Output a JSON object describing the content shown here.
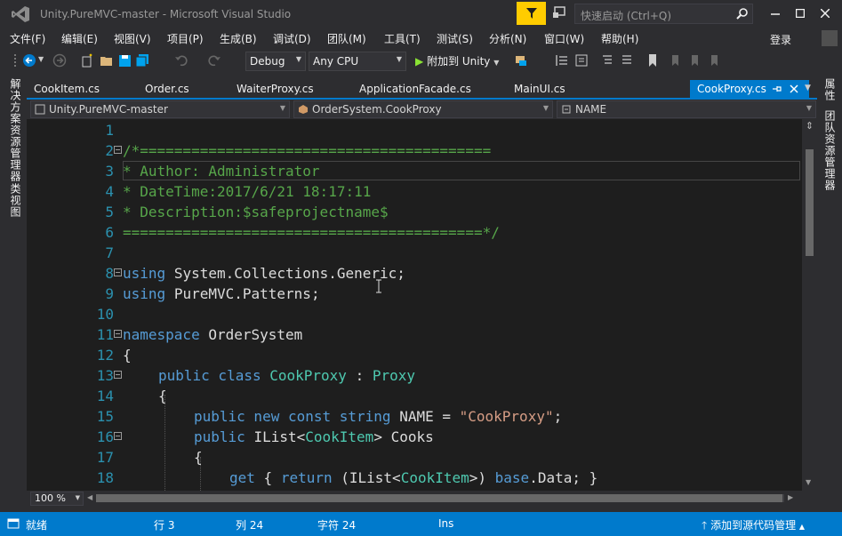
{
  "window": {
    "title": "Unity.PureMVC-master - Microsoft Visual Studio",
    "quick_launch_placeholder": "快速启动 (Ctrl+Q)",
    "login": "登录"
  },
  "menu": [
    "文件(F)",
    "编辑(E)",
    "视图(V)",
    "项目(P)",
    "生成(B)",
    "调试(D)",
    "团队(M)",
    "工具(T)",
    "测试(S)",
    "分析(N)",
    "窗口(W)",
    "帮助(H)"
  ],
  "toolbar": {
    "configuration": "Debug",
    "platform": "Any CPU",
    "attach_label": "附加到 Unity"
  },
  "left_panels": [
    "解决方案资源管理器",
    "类视图"
  ],
  "right_panels": [
    "属性",
    "团队资源管理器"
  ],
  "tabs": [
    "CookItem.cs",
    "Order.cs",
    "WaiterProxy.cs",
    "ApplicationFacade.cs",
    "MainUI.cs",
    "CookProxy.cs"
  ],
  "active_tab": "CookProxy.cs",
  "navigation": {
    "project": "Unity.PureMVC-master",
    "type": "OrderSystem.CookProxy",
    "member": "NAME"
  },
  "code": {
    "line_numbers": [
      "1",
      "2",
      "3",
      "4",
      "5",
      "6",
      "7",
      "8",
      "9",
      "10",
      "11",
      "12",
      "13",
      "14",
      "15",
      "16",
      "17",
      "18"
    ],
    "comment_open": "/*=========================================",
    "comment_author": "* Author: Administrator",
    "comment_datetime": "* DateTime:2017/6/21 18:17:11",
    "comment_description": "* Description:$safeprojectname$",
    "comment_close": "==========================================*/",
    "using_kw": "using",
    "using1_ns": "System.Collections.Generic;",
    "using2_ns": "PureMVC.Patterns;",
    "namespace_kw": "namespace",
    "namespace_name": "OrderSystem",
    "open_brace": "{",
    "public_class": "public class",
    "class_name": "CookProxy",
    "colon": " : ",
    "base_class": "Proxy",
    "const_mods": "public new const string",
    "const_name": " NAME = ",
    "const_value": "\"CookProxy\"",
    "semicolon": ";",
    "public_kw": "public",
    "ilist": "IList",
    "lt": "<",
    "cookitem": "CookItem",
    "gt": ">",
    "cooks": " Cooks",
    "get_kw": "get",
    "get_open": " { ",
    "return_kw": "return",
    "cast_open": " (",
    "cast_close": ">) ",
    "base_kw": "base",
    "data_tail": ".Data; }"
  },
  "zoom": "100 %",
  "status": {
    "ready": "就绪",
    "line": "行 3",
    "col": "列 24",
    "char": "字符 24",
    "mode": "Ins",
    "source_control": "添加到源代码管理"
  },
  "colors": {
    "accent": "#007acc",
    "filter": "#ffcc00",
    "editor_bg": "#1e1e1e",
    "keyword": "#569cd6",
    "type": "#4ec9b0",
    "comment": "#57a64a",
    "string": "#d69d85"
  }
}
